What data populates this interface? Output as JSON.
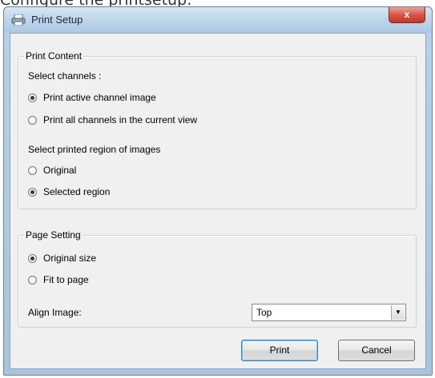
{
  "caption_above": "Configure the printsetup:",
  "window": {
    "title": "Print Setup",
    "close_glyph": "x"
  },
  "print_content": {
    "group_label": "Print Content",
    "select_channels_label": "Select channels :",
    "channel_options": [
      {
        "label": "Print active channel image",
        "selected": true
      },
      {
        "label": "Print all channels in the current view",
        "selected": false
      }
    ],
    "select_region_label": "Select printed region of images",
    "region_options": [
      {
        "label": "Original",
        "selected": false
      },
      {
        "label": "Selected region",
        "selected": true
      }
    ]
  },
  "page_setting": {
    "group_label": "Page Setting",
    "size_options": [
      {
        "label": "Original size",
        "selected": true
      },
      {
        "label": "Fit to page",
        "selected": false
      }
    ],
    "align_label": "Align Image:",
    "align_value": "Top",
    "dropdown_glyph": "▼"
  },
  "buttons": {
    "print_label": "Print",
    "cancel_label": "Cancel"
  }
}
